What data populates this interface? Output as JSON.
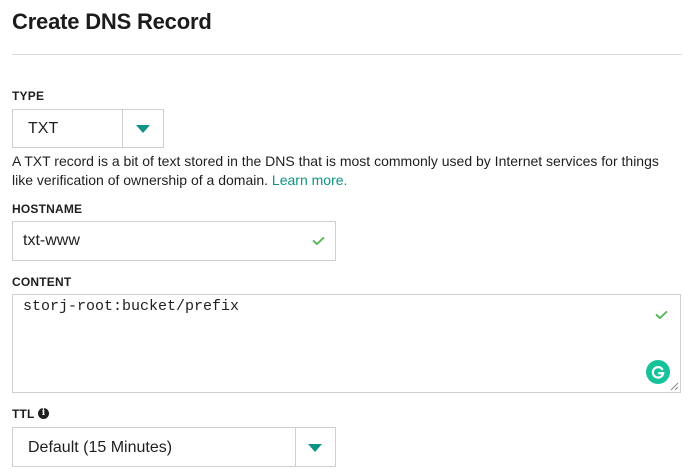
{
  "page": {
    "title": "Create DNS Record"
  },
  "type_field": {
    "label": "TYPE",
    "value": "TXT",
    "icon": "chevron-down-icon"
  },
  "help": {
    "text": "A TXT record is a bit of text stored in the DNS that is most commonly used by Internet services for things like verification of ownership of a domain.",
    "link_text": "Learn more."
  },
  "hostname_field": {
    "label": "HOSTNAME",
    "value": "txt-www",
    "status_icon": "checkmark-icon"
  },
  "content_field": {
    "label": "CONTENT",
    "value": "storj-root:bucket/prefix",
    "status_icon": "checkmark-icon",
    "extension_icon": "grammarly-icon"
  },
  "ttl_field": {
    "label": "TTL",
    "info_icon": "info-icon",
    "value": "Default (15 Minutes)",
    "icon": "chevron-down-icon"
  },
  "colors": {
    "accent": "#0e9384",
    "check": "#5cb85c",
    "grammarly": "#15c39a",
    "border": "#cfcfcf"
  }
}
